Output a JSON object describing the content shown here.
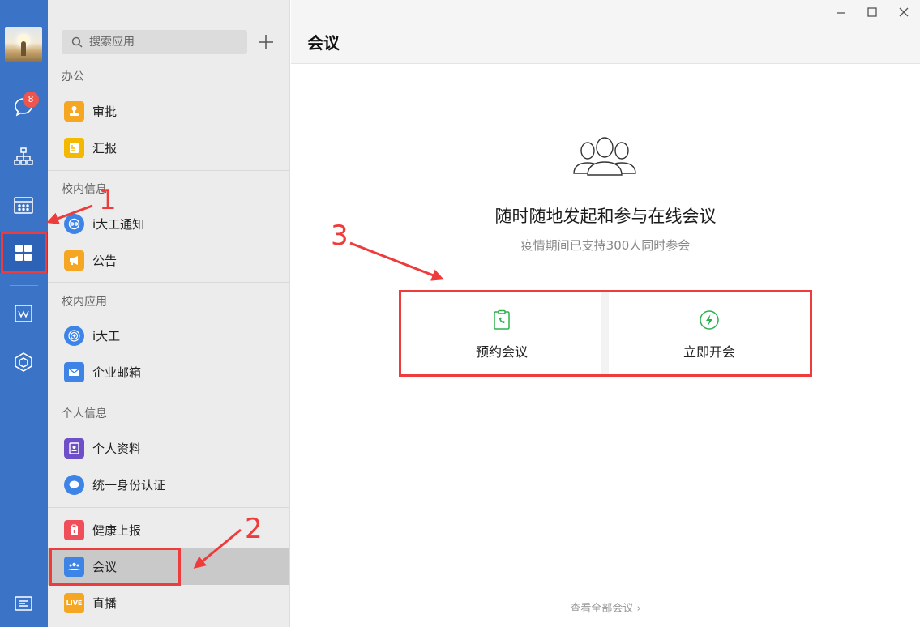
{
  "rail": {
    "badge_count": "8",
    "icons": [
      "avatar",
      "chat-icon",
      "org-chart-icon",
      "calendar-icon",
      "apps-grid-icon",
      "docs-icon",
      "cube-icon",
      "settings-icon"
    ]
  },
  "panel": {
    "search_placeholder": "搜索应用",
    "sections": [
      {
        "title": "办公",
        "items": [
          {
            "label": "审批",
            "color": "#f5a623"
          },
          {
            "label": "汇报",
            "color": "#f5b800"
          }
        ]
      },
      {
        "title": "校内信息",
        "items": [
          {
            "label": "i大工通知",
            "color": "#3d84e6"
          },
          {
            "label": "公告",
            "color": "#f5a623"
          }
        ]
      },
      {
        "title": "校内应用",
        "items": [
          {
            "label": "i大工",
            "color": "#3d84e6"
          },
          {
            "label": "企业邮箱",
            "color": "#3d84e6"
          }
        ]
      },
      {
        "title": "个人信息",
        "items": [
          {
            "label": "个人资料",
            "color": "#6f4fc7"
          },
          {
            "label": "统一身份认证",
            "color": "#3d84e6"
          }
        ]
      },
      {
        "title": "",
        "items": [
          {
            "label": "健康上报",
            "color": "#ef4e5a"
          },
          {
            "label": "会议",
            "color": "#3d84e6"
          },
          {
            "label": "直播",
            "color": "#f5a623"
          }
        ]
      }
    ],
    "live_badge": "LIVE"
  },
  "main": {
    "title": "会议",
    "headline": "随时随地发起和参与在线会议",
    "subline": "疫情期间已支持300人同时参会",
    "schedule_label": "预约会议",
    "start_label": "立即开会",
    "view_all": "查看全部会议 ›",
    "accent": "#2bb24c"
  },
  "annotations": {
    "n1": "1",
    "n2": "2",
    "n3": "3",
    "color": "#ee3b3b"
  }
}
